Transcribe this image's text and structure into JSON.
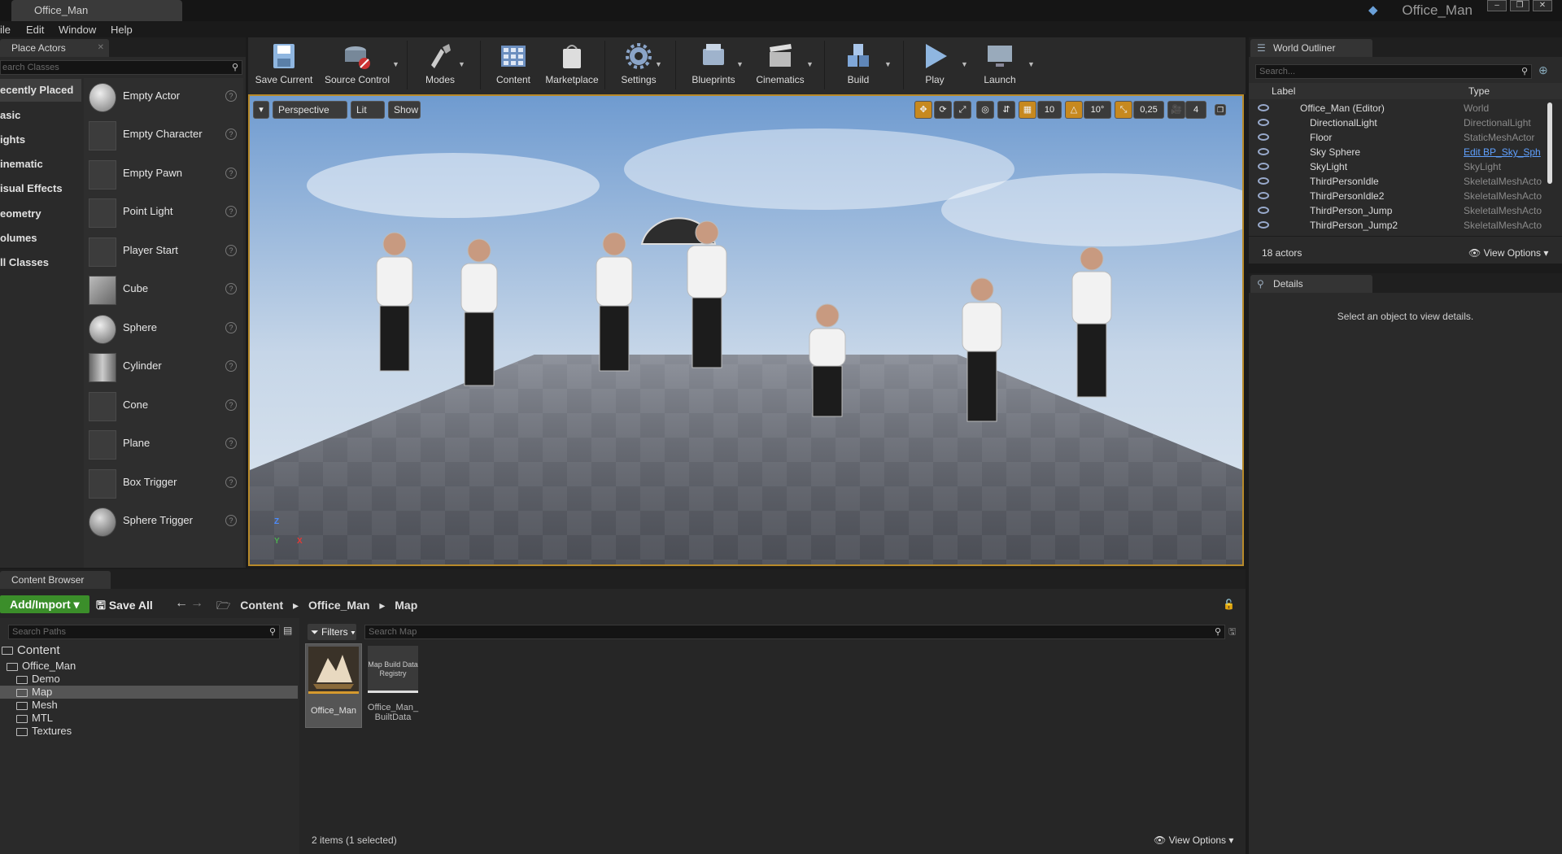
{
  "window": {
    "tab_title": "Office_Man",
    "app_title": "Office_Man"
  },
  "menu": [
    "ile",
    "Edit",
    "Window",
    "Help"
  ],
  "place_actors": {
    "tab": "Place Actors",
    "search_placeholder": "earch Classes",
    "categories": [
      "ecently Placed",
      "asic",
      "ights",
      "inematic",
      "isual Effects",
      "eometry",
      "olumes",
      "ll Classes"
    ],
    "items": [
      "Empty Actor",
      "Empty Character",
      "Empty Pawn",
      "Point Light",
      "Player Start",
      "Cube",
      "Sphere",
      "Cylinder",
      "Cone",
      "Plane",
      "Box Trigger",
      "Sphere Trigger"
    ],
    "help_glyph": "?"
  },
  "toolbar": {
    "buttons": [
      "Save Current",
      "Source Control",
      "Modes",
      "Content",
      "Marketplace",
      "Settings",
      "Blueprints",
      "Cinematics",
      "Build",
      "Play",
      "Launch"
    ]
  },
  "viewport": {
    "view_mode": "Perspective",
    "lighting": "Lit",
    "show": "Show",
    "grid_snap": "10",
    "rotation_snap": "10°",
    "scale_snap": "0,25",
    "camera_speed": "4",
    "axis_z": "Z",
    "axis_y": "Y",
    "axis_x": "X"
  },
  "outliner": {
    "tab": "World Outliner",
    "search_placeholder": "Search...",
    "col_label": "Label",
    "col_type": "Type",
    "rows": [
      {
        "label": "Office_Man (Editor)",
        "type": "World"
      },
      {
        "label": "DirectionalLight",
        "type": "DirectionalLight"
      },
      {
        "label": "Floor",
        "type": "StaticMeshActor"
      },
      {
        "label": "Sky Sphere",
        "type": "Edit BP_Sky_Sph"
      },
      {
        "label": "SkyLight",
        "type": "SkyLight"
      },
      {
        "label": "ThirdPersonIdle",
        "type": "SkeletalMeshActo"
      },
      {
        "label": "ThirdPersonIdle2",
        "type": "SkeletalMeshActo"
      },
      {
        "label": "ThirdPerson_Jump",
        "type": "SkeletalMeshActo"
      },
      {
        "label": "ThirdPerson_Jump2",
        "type": "SkeletalMeshActo"
      }
    ],
    "count": "18 actors",
    "view_options": "View Options"
  },
  "details": {
    "tab": "Details",
    "empty_message": "Select an object to view details."
  },
  "content_browser": {
    "tab": "Content Browser",
    "add_import": "Add/Import",
    "save_all": "Save All",
    "breadcrumb": [
      "Content",
      "Office_Man",
      "Map"
    ],
    "paths_placeholder": "Search Paths",
    "filters": "Filters",
    "search_map_placeholder": "Search Map",
    "tree": [
      "Content",
      "Office_Man",
      "Demo",
      "Map",
      "Mesh",
      "MTL",
      "Textures"
    ],
    "assets": [
      {
        "name": "Office_Man",
        "thumb_text": ""
      },
      {
        "name": "Office_Man_\nBuiltData",
        "thumb_text": "Map Build Data Registry"
      }
    ],
    "status": "2 items (1 selected)",
    "view_options": "View Options"
  },
  "colors": {
    "viewport_border": "#b88a2a",
    "accent_green": "#3b8e2a",
    "link_blue": "#5fa0ff"
  }
}
